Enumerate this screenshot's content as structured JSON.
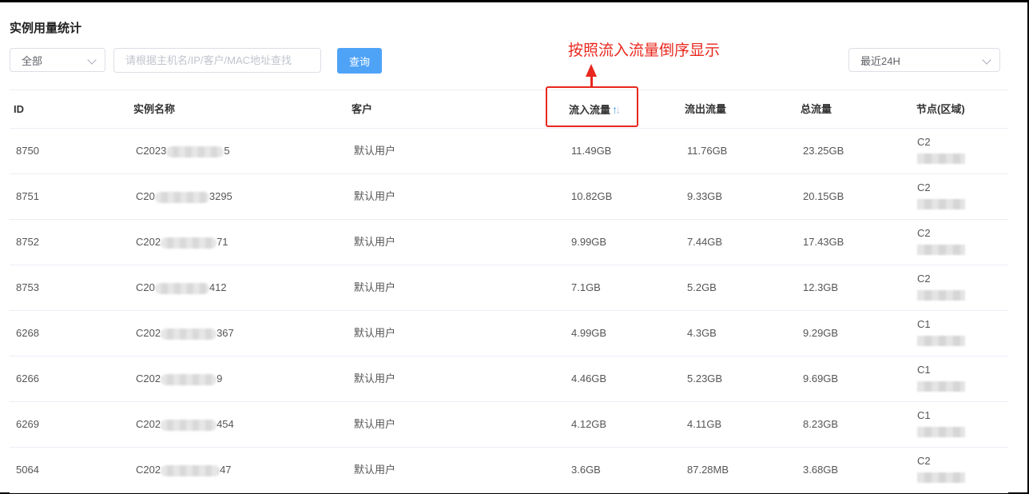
{
  "page": {
    "title": "实例用量统计"
  },
  "filters": {
    "scope": {
      "value": "全部"
    },
    "search": {
      "placeholder": "请根据主机名/IP/客户/MAC地址查找"
    },
    "query_label": "查询",
    "time_range": {
      "value": "最近24H"
    }
  },
  "annotation": {
    "text": "按照流入流量倒序显示",
    "color": "#e8281e"
  },
  "table": {
    "columns": {
      "id": "ID",
      "name": "实例名称",
      "customer": "客户",
      "in": "流入流量",
      "out": "流出流量",
      "total": "总流量",
      "node": "节点(区域)"
    },
    "sort": {
      "column": "in",
      "icon": "sort-arrows-icon"
    },
    "rows": [
      {
        "id": "8750",
        "name_prefix": "C2023",
        "name_suffix": "5",
        "customer": "默认用户",
        "in": "11.49GB",
        "out": "11.76GB",
        "total": "23.25GB",
        "node": "C2"
      },
      {
        "id": "8751",
        "name_prefix": "C20",
        "name_suffix": "3295",
        "customer": "默认用户",
        "in": "10.82GB",
        "out": "9.33GB",
        "total": "20.15GB",
        "node": "C2"
      },
      {
        "id": "8752",
        "name_prefix": "C202",
        "name_suffix": "71",
        "customer": "默认用户",
        "in": "9.99GB",
        "out": "7.44GB",
        "total": "17.43GB",
        "node": "C2"
      },
      {
        "id": "8753",
        "name_prefix": "C20",
        "name_suffix": "412",
        "customer": "默认用户",
        "in": "7.1GB",
        "out": "5.2GB",
        "total": "12.3GB",
        "node": "C2"
      },
      {
        "id": "6268",
        "name_prefix": "C202",
        "name_suffix": "367",
        "customer": "默认用户",
        "in": "4.99GB",
        "out": "4.3GB",
        "total": "9.29GB",
        "node": "C1"
      },
      {
        "id": "6266",
        "name_prefix": "C202",
        "name_suffix": "9",
        "customer": "默认用户",
        "in": "4.46GB",
        "out": "5.23GB",
        "total": "9.69GB",
        "node": "C1"
      },
      {
        "id": "6269",
        "name_prefix": "C202",
        "name_suffix": "454",
        "customer": "默认用户",
        "in": "4.12GB",
        "out": "4.11GB",
        "total": "8.23GB",
        "node": "C1"
      },
      {
        "id": "5064",
        "name_prefix": "C202",
        "name_suffix": "47",
        "customer": "默认用户",
        "in": "3.6GB",
        "out": "87.28MB",
        "total": "3.68GB",
        "node": "C2"
      }
    ]
  }
}
